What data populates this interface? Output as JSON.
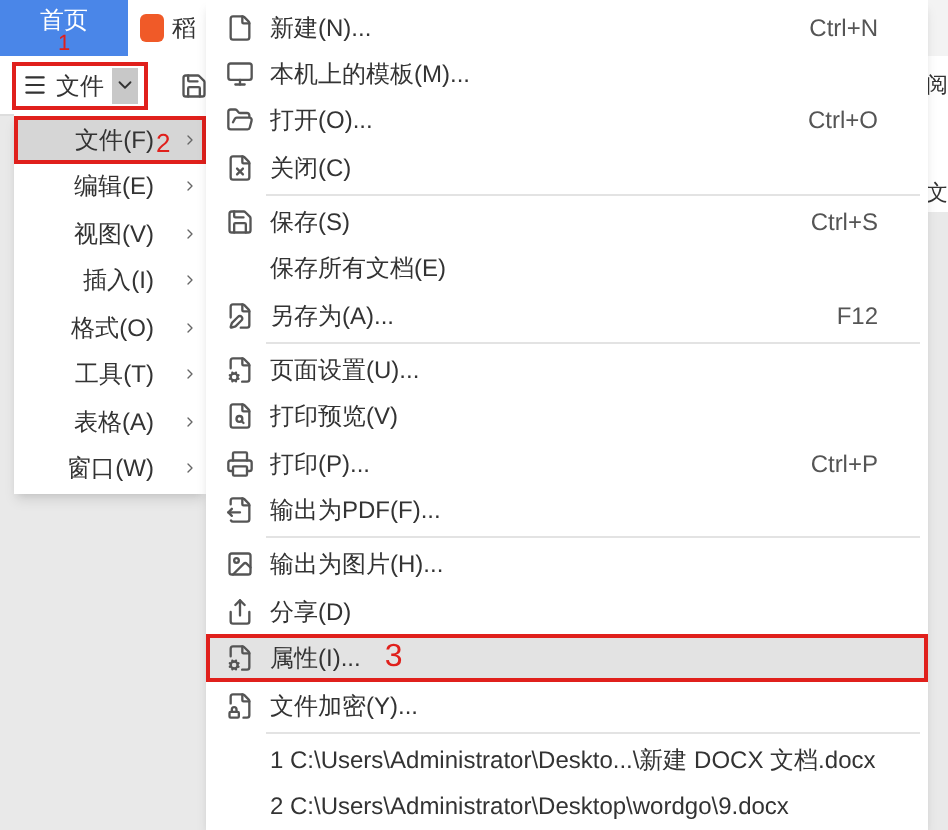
{
  "tabs": [
    {
      "label": "首页",
      "selected": true,
      "annotation": "1"
    },
    {
      "label": "稻",
      "selected": false
    }
  ],
  "toolbar": {
    "file_button": {
      "label": "文件",
      "annotated": true
    }
  },
  "edge_texts": [
    "阅",
    "文"
  ],
  "left_menu": [
    {
      "label": "文件(F)",
      "selected": true,
      "annotation": "2"
    },
    {
      "label": "编辑(E)",
      "selected": false
    },
    {
      "label": "视图(V)",
      "selected": false
    },
    {
      "label": "插入(I)",
      "selected": false
    },
    {
      "label": "格式(O)",
      "selected": false
    },
    {
      "label": "工具(T)",
      "selected": false
    },
    {
      "label": "表格(A)",
      "selected": false
    },
    {
      "label": "窗口(W)",
      "selected": false
    }
  ],
  "file_menu": [
    {
      "kind": "item",
      "label": "新建(N)...",
      "shortcut": "Ctrl+N",
      "selected": false
    },
    {
      "kind": "item",
      "label": "本机上的模板(M)...",
      "selected": false
    },
    {
      "kind": "item",
      "label": "打开(O)...",
      "shortcut": "Ctrl+O",
      "selected": false
    },
    {
      "kind": "item",
      "label": "关闭(C)",
      "selected": false
    },
    {
      "kind": "separator"
    },
    {
      "kind": "item",
      "label": "保存(S)",
      "shortcut": "Ctrl+S",
      "selected": false
    },
    {
      "kind": "item",
      "label": "保存所有文档(E)",
      "selected": false
    },
    {
      "kind": "item",
      "label": "另存为(A)...",
      "shortcut": "F12",
      "selected": false
    },
    {
      "kind": "separator"
    },
    {
      "kind": "item",
      "label": "页面设置(U)...",
      "selected": false
    },
    {
      "kind": "item",
      "label": "打印预览(V)",
      "selected": false
    },
    {
      "kind": "item",
      "label": "打印(P)...",
      "shortcut": "Ctrl+P",
      "selected": false
    },
    {
      "kind": "item",
      "label": "输出为PDF(F)...",
      "selected": false
    },
    {
      "kind": "separator"
    },
    {
      "kind": "item",
      "label": "输出为图片(H)...",
      "selected": false
    },
    {
      "kind": "item",
      "label": "分享(D)",
      "selected": false
    },
    {
      "kind": "item",
      "label": "属性(I)...",
      "selected": true,
      "annotation": "3"
    },
    {
      "kind": "item",
      "label": "文件加密(Y)...",
      "selected": false
    },
    {
      "kind": "separator"
    },
    {
      "kind": "recent",
      "label": "1 C:\\Users\\Administrator\\Deskto...\\新建 DOCX 文档.docx"
    },
    {
      "kind": "recent",
      "label": "2 C:\\Users\\Administrator\\Desktop\\wordgo\\9.docx"
    }
  ]
}
